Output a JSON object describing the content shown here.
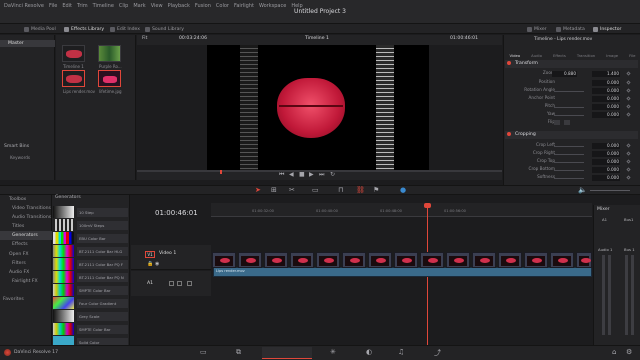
{
  "menu": [
    "DaVinci Resolve",
    "File",
    "Edit",
    "Trim",
    "Timeline",
    "Clip",
    "Mark",
    "View",
    "Playback",
    "Fusion",
    "Color",
    "Fairlight",
    "Workspace",
    "Help"
  ],
  "project_title": "Untitled Project 3",
  "toolbar_left": {
    "media_pool": "Media Pool",
    "effects_library": "Effects Library",
    "edit_index": "Edit Index",
    "sound_library": "Sound Library"
  },
  "toolbar_right": {
    "mixer": "Mixer",
    "metadata": "Metadata",
    "inspector": "Inspector"
  },
  "viewer": {
    "zoom": "Fit",
    "timecode_left": "00:03:24:06",
    "timeline_name": "Timeline 1",
    "timecode_right": "01:00:46:01"
  },
  "inspector_title": "Timeline - Lips render.mov",
  "inspector_tabs": [
    "Video",
    "Audio",
    "Effects",
    "Transition",
    "Image",
    "File"
  ],
  "media_pool": {
    "bin": "Master",
    "items": [
      "Timeline 1",
      "Purple Ro...",
      "Lips render.mov",
      "lifetime.jpg"
    ]
  },
  "smart_bins": {
    "title": "Smart Bins",
    "item": "Keywords"
  },
  "toolbox": {
    "items": [
      "Toolbox",
      "Video Transitions",
      "Audio Transitions",
      "Titles",
      "Generators",
      "Effects",
      "Open FX",
      "Filters",
      "Audio FX",
      "Fairlight FX"
    ],
    "favorites": "Favorites"
  },
  "generators": {
    "title": "Generators",
    "items": [
      "10 Step",
      "100mV Steps",
      "EBU Color Bar",
      "BT.2111 Color Bar HLG",
      "BT.2111 Color Bar PQ F",
      "BT.2111 Color Bar PQ N",
      "SMPTE Color Bar",
      "Four Color Gradient",
      "Grey Scale",
      "SMPTE Color Bar",
      "Solid Color"
    ]
  },
  "inspector": {
    "transform": {
      "title": "Transform",
      "rows": [
        {
          "k": "Zoom",
          "v": "0.880",
          "v2": "1.400"
        },
        {
          "k": "Position",
          "v": "0.000"
        },
        {
          "k": "Rotation Angle",
          "v": "0.000"
        },
        {
          "k": "Anchor Point",
          "v": "0.000"
        },
        {
          "k": "Pitch",
          "v": "0.000"
        },
        {
          "k": "Yaw",
          "v": "0.000"
        },
        {
          "k": "Flip",
          "v": ""
        }
      ]
    },
    "cropping": {
      "title": "Cropping",
      "rows": [
        {
          "k": "Crop Left",
          "v": "0.000"
        },
        {
          "k": "Crop Right",
          "v": "0.000"
        },
        {
          "k": "Crop Top",
          "v": "0.000"
        },
        {
          "k": "Crop Bottom",
          "v": "0.000"
        },
        {
          "k": "Softness",
          "v": "0.000"
        }
      ]
    }
  },
  "timeline": {
    "timecode": "01:00:46:01",
    "ruler": [
      "01:00:32:00",
      "01:00:40:00",
      "01:00:48:00",
      "01:00:56:00"
    ],
    "video_track": "V1",
    "video_name": "Video 1",
    "audio_track": "A1",
    "audio_clip": "Lips render.mov"
  },
  "mixer": {
    "title": "Mixer",
    "a1": "A1",
    "bus1": "Bus1",
    "audio1": "Audio 1",
    "bus1b": "Bus 1"
  },
  "footer": {
    "app": "DaVinci Resolve 17"
  },
  "colors": {
    "accent": "#e0473a",
    "clip": "#3b3f52",
    "audio": "#3a6a8a",
    "lips": "#d0304c"
  }
}
